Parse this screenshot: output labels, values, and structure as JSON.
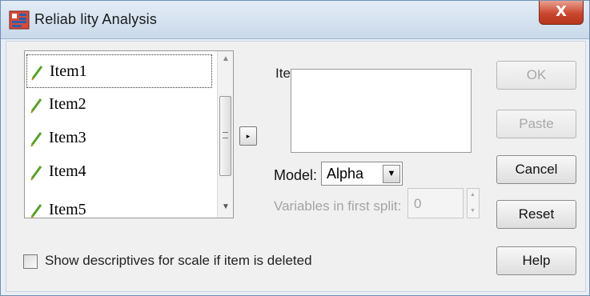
{
  "window": {
    "title": "Reliab lity Analysis",
    "close_label": "X"
  },
  "variables": {
    "items": [
      {
        "label": "Item1",
        "selected": true
      },
      {
        "label": "Item2",
        "selected": false
      },
      {
        "label": "Item3",
        "selected": false
      },
      {
        "label": "Item4",
        "selected": false
      },
      {
        "label": "Item5",
        "selected": false
      }
    ],
    "scroll_up_glyph": "▲",
    "scroll_down_glyph": "▼",
    "icon": "pencil-scale-icon"
  },
  "move_button_glyph": "▸",
  "items_panel": {
    "label": "Items",
    "label_mnemonic": "I"
  },
  "model": {
    "label": "Model:",
    "value": "Alpha",
    "arrow_glyph": "▼"
  },
  "split": {
    "label": "Variables in first split:",
    "value": "0"
  },
  "buttons": {
    "ok": "OK",
    "paste": "Paste",
    "cancel": "Cancel",
    "reset": "Reset",
    "help": "Help"
  },
  "show_descriptives": {
    "label": "Show descriptives for scale if item is deleted",
    "checked": false
  },
  "colors": {
    "accent": "#c9472e",
    "titlebar": "#c9d9ea",
    "pencil": "#5aa02c"
  }
}
